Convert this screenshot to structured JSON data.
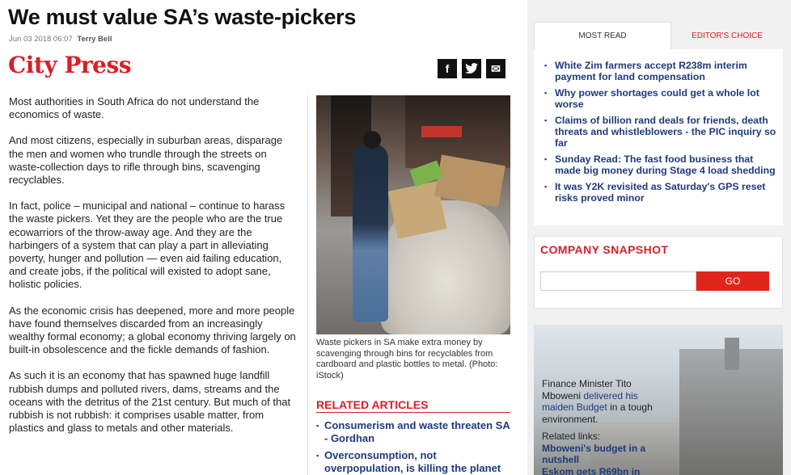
{
  "article": {
    "headline": "We must value SA’s waste-pickers",
    "date": "Jun 03 2018 06:07",
    "author": "Terry Bell",
    "brand": "City Press",
    "paragraphs": [
      "Most authorities in South Africa do not understand the economics of waste.",
      "And most citizens, especially in suburban areas, disparage the men and women who trundle through the streets on waste-collection days to rifle through bins, scavenging recyclables.",
      "In fact, police – municipal and national – continue to harass the waste pickers. Yet they are the people who are the true ecowarriors of the throw-away age. And they are the harbingers of a system that can play a part in alleviating poverty, hunger and pollution — even aid failing education, and create jobs, if the political will existed to adopt sane, holistic policies.",
      "As the economic crisis has deepened, more and more people have found themselves discarded from an increasingly wealthy formal economy; a global economy thriving largely on built-in obsolescence and the fickle demands of fashion.",
      "As such it is an economy that has spawned huge landfill rubbish dumps and polluted rivers, dams, streams and the oceans with the detritus of the 21st century. But much of that rubbish is not rubbish: it comprises usable matter, from plastics and glass to metals and other materials."
    ],
    "photo_caption": "Waste pickers in SA make extra money by scavenging through bins for recyclables from cardboard and plastic bottles to metal. (Photo: iStock)"
  },
  "share": {
    "facebook": "f",
    "twitter": "t",
    "email": "✉"
  },
  "related": {
    "title": "RELATED ARTICLES",
    "items": [
      "Consumerism and waste threaten SA - Gordhan",
      "Overconsumption, not overpopulation, is killing the planet"
    ]
  },
  "sidebar": {
    "tabs": [
      "MOST READ",
      "EDITOR'S CHOICE"
    ],
    "most_read": [
      "White Zim farmers accept R238m interim payment for land compensation",
      "Why power shortages could get a whole lot worse",
      "Claims of billion rand deals for friends, death threats and whistleblowers - the PIC inquiry so far",
      "Sunday Read: The fast food business that made big money during Stage 4 load shedding",
      "It was Y2K revisited as Saturday's GPS reset risks proved minor"
    ],
    "company_snapshot": {
      "title": "COMPANY SNAPSHOT",
      "input_value": "",
      "go_label": "GO"
    },
    "promo": {
      "text_prefix": "Finance Minister Tito Mboweni ",
      "text_link": "delivered his maiden Budget",
      "text_suffix": " in a tough environment.",
      "related_links_label": "Related links:",
      "links": [
        "Mboweni's budget in a nutshell",
        "Eskom gets R69bn in"
      ]
    }
  },
  "colors": {
    "brand_red": "#d81f26",
    "link_blue": "#1f3a7a",
    "sidebar_bg": "#f1f1f1"
  }
}
